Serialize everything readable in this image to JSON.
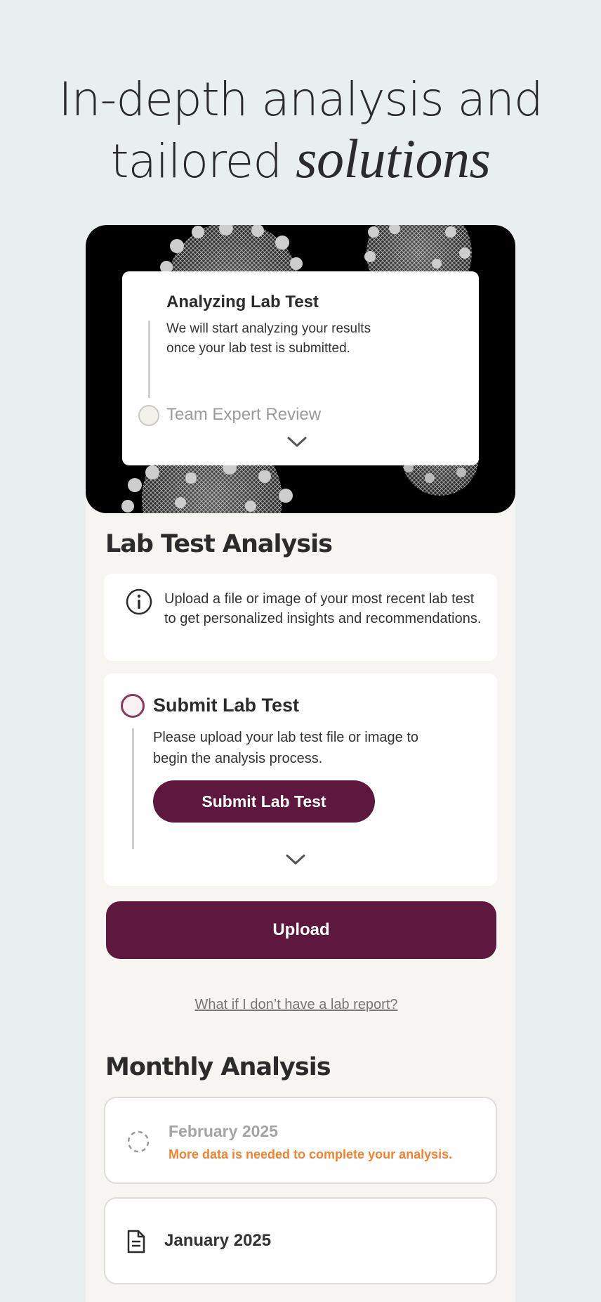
{
  "headline": {
    "line1": "In-depth analysis and",
    "line2_plain": "tailored ",
    "line2_italic": "solutions"
  },
  "hero_card": {
    "title": "Analyzing Lab Test",
    "description": "We will start analyzing your results once your lab test is submitted.",
    "next_step": "Team Expert Review"
  },
  "lab_section": {
    "title": "Lab Test Analysis",
    "info_text": "Upload a file or image of your most recent lab test to get personalized insights and recommendations.",
    "submit_step": {
      "title": "Submit Lab Test",
      "description": "Please upload your lab test file or image to begin the analysis process.",
      "button_label": "Submit Lab Test"
    },
    "upload_label": "Upload",
    "help_link": "What if I don’t have a lab report?"
  },
  "monthly_section": {
    "title": "Monthly Analysis",
    "items": [
      {
        "month": "February 2025",
        "status": "More data is needed to complete your analysis.",
        "icon": "loading-spinner-icon"
      },
      {
        "month": "January 2025",
        "icon": "document-icon"
      }
    ]
  },
  "colors": {
    "brand": "#5e173d",
    "warning": "#f4812e",
    "background": "#e8efee",
    "panel": "#f6f5f2"
  }
}
